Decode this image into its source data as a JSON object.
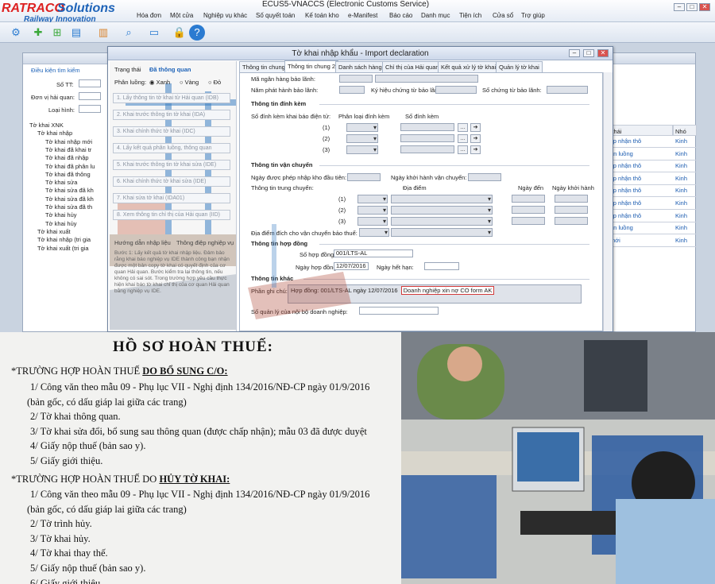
{
  "app": {
    "window_title": "ECUS5-VNACCS (Electronic Customs Service)",
    "logo_part1": "RATRACO",
    "logo_part2": "Solutions",
    "logo_tagline": "Railway Innovation",
    "menu": [
      "Hóa đơn",
      "Một cửa",
      "Nghiệp vụ khác",
      "Số quyết toán",
      "Kế toán kho",
      "e-Manifest",
      "Báo cáo",
      "Danh mục",
      "Tiện ích",
      "Cửa sổ",
      "Trợ giúp"
    ],
    "toolbar_icons": [
      "gear-icon",
      "add-icon",
      "add-list-icon",
      "document-icon",
      "chart-icon",
      "search-icon",
      "monitor-icon",
      "lock-icon",
      "help-icon"
    ]
  },
  "search_panel": {
    "title": "Điều kiện tìm kiếm",
    "so_tt_label": "Số TT:",
    "don_vi_label": "Đơn vị hải quan:",
    "loai_hinh_label": "Loại hình:"
  },
  "tree": [
    {
      "label": "Tờ khai XNK",
      "level": 0
    },
    {
      "label": "Tờ khai nhập",
      "level": 1
    },
    {
      "label": "Tờ khai nhập mới",
      "level": 2
    },
    {
      "label": "Tờ khai đã khai tr",
      "level": 2
    },
    {
      "label": "Tờ khai đã nhập",
      "level": 2
    },
    {
      "label": "Tờ khai đã phân lu",
      "level": 2
    },
    {
      "label": "Tờ khai đã thông",
      "level": 2
    },
    {
      "label": "Tờ khai sửa",
      "level": 2
    },
    {
      "label": "Tờ khai sửa đã kh",
      "level": 2
    },
    {
      "label": "Tờ khai sửa đã kh",
      "level": 2
    },
    {
      "label": "Tờ khai sửa đã th",
      "level": 2
    },
    {
      "label": "Tờ khai hủy",
      "level": 2
    },
    {
      "label": "Tờ khai hủy",
      "level": 2
    },
    {
      "label": "Tờ khai xuất",
      "level": 1
    },
    {
      "label": "Tờ khai nhập (tri gia",
      "level": 1
    },
    {
      "label": "Tờ khai xuất (tri gia",
      "level": 1
    }
  ],
  "grid": {
    "headers": [
      "Trạng thái",
      "Nhó"
    ],
    "rows": [
      [
        "Đã chấp nhận thô",
        "Kinh"
      ],
      [
        "Đã phân luồng",
        "Kinh"
      ],
      [
        "Đã chấp nhận thô",
        "Kinh"
      ],
      [
        "Đã chấp nhận thô",
        "Kinh"
      ],
      [
        "Đã chấp nhận thô",
        "Kinh"
      ],
      [
        "Đã chấp nhận thô",
        "Kinh"
      ],
      [
        "Đã chấp nhận thô",
        "Kinh"
      ],
      [
        "Đã phân luồng",
        "Kinh"
      ],
      [
        "Nhập mới",
        "Kinh"
      ]
    ]
  },
  "dialog": {
    "title": "Tờ khai nhập khẩu - Import declaration",
    "status_label": "Trạng thái",
    "status_value": "Đã thông quan",
    "lane_label": "Phân luồng:",
    "lanes": [
      "Xanh",
      "Vàng",
      "Đỏ"
    ],
    "left_buttons": [
      "1. Lấy thông tin tờ khai từ Hải quan (IDB)",
      "2. Khai trước thông tin tờ khai (IDA)",
      "3. Khai chính thức tờ khai (IDC)",
      "4. Lấy kết quả phân luồng, thông quan",
      "5. Khai trước thông tin tờ khai sửa (IDE)",
      "6. Khai chính thức tờ khai sửa (IDE)",
      "7. Khai sửa tờ khai (IDA01)",
      "8. Xem thông tin chỉ thị của Hải quan (IID)"
    ],
    "guide_tab": "Hướng dẫn nhập liệu",
    "message_tab": "Thông điệp nghiệp vụ",
    "guide_text": "Bước 1: Lấy kết quả tờ khai nhập liệu. Đảm bảo rằng khai báo nghiệp vụ IDE thành công bạn nhận được một bản copy tờ khai có quyết định của cơ quan Hải quan. Bước kiểm tra lại thông tin, nếu không có sai sót. Trong trường hợp yêu cầu thực hiện khai báo tờ khai chỉ thị của cơ quan Hải quan bằng nghiệp vụ IDE.",
    "tabs": [
      "Thông tin chung",
      "Thông tin chung 2",
      "Danh sách hàng",
      "Chỉ thị của Hải quan",
      "Kết quả xử lý tờ khai",
      "Quản lý tờ khai"
    ],
    "active_tab": 1,
    "fields": {
      "ma_ngan_hang": "Mã ngân hàng bảo lãnh:",
      "nam_phat_hanh": "Năm phát hành bảo lãnh:",
      "ky_hieu_chung_tu": "Ký hiệu chứng từ bảo lãnh:",
      "so_chung_tu": "Số chứng từ bảo lãnh:"
    },
    "attach_section": "Thông tin đính kèm",
    "attach_number_label": "Số đính kèm khai báo điện tử:",
    "attach_type_header": "Phân loại đính kèm",
    "attach_num_header": "Số đính kèm",
    "attach_rows": [
      "(1)",
      "(2)",
      "(3)"
    ],
    "transport_section": "Thông tin vận chuyển",
    "transport_date_label": "Ngày được phép nhập kho đầu tiên:",
    "transport_start_label": "Ngày khởi hành vận chuyển:",
    "transit_label": "Thông tin trung chuyển:",
    "place_header": "Địa điểm",
    "arrive_header": "Ngày đến",
    "depart_header": "Ngày khởi hành",
    "transit_rows": [
      "(1)",
      "(2)",
      "(3)"
    ],
    "destination_label": "Địa điểm đích cho vận chuyển bảo thuế:",
    "contract_section": "Thông tin hợp đồng",
    "contract_no_label": "Số hợp đồng:",
    "contract_no": "001/LTS-AL",
    "contract_date_label": "Ngày hợp đồng:",
    "contract_date": "12/07/2016",
    "expiry_label": "Ngày hết hạn:",
    "other_section": "Thông tin khác",
    "note_label": "Phần ghi chú:",
    "note_value": "Hợp đồng: 001/LTS-AL ngày 12/07/2016",
    "note_highlight": "Doanh nghiệp xin nợ CO form AK",
    "internal_no_label": "Số quản lý của nội bộ doanh nghiệp:"
  },
  "document": {
    "heading": "HỒ SƠ HOÀN THUẾ:",
    "case1_prefix": "*TRƯỜNG HỢP HOÀN THUẾ ",
    "case1_underlined": "DO BỔ SUNG C/O:",
    "case1_items": [
      "1/ Công văn theo mẫu 09 - Phụ lục VII - Nghị định 134/2016/NĐ-CP ngày 01/9/2016",
      "(bản gốc, có dấu giáp lai giữa các trang)",
      "2/ Tờ khai thông quan.",
      "3/ Tờ khai sửa đổi, bổ sung sau thông quan (được chấp nhận); mẫu 03 đã được duyệt",
      "4/ Giấy nộp thuế (bản sao y).",
      "5/ Giấy giới thiệu."
    ],
    "case2_prefix": "*TRƯỜNG HỢP HOÀN THUẾ DO ",
    "case2_underlined": "HỦY TỜ KHAI:",
    "case2_items": [
      "1/ Công văn theo mẫu 09 - Phụ lục VII - Nghị định 134/2016/NĐ-CP ngày 01/9/2016",
      "(bản gốc, có dấu giáp lai giữa các trang)",
      "2/ Tờ trình hủy.",
      "3/ Tờ khai hủy.",
      "4/ Tờ khai thay thế.",
      "5/ Giấy nộp thuế (bản sao y).",
      "6/ Giấy giới thiệu."
    ]
  },
  "colors": {
    "accent": "#1e63b8",
    "logo_red": "#d22222",
    "highlight_box": "#d23a3a"
  }
}
